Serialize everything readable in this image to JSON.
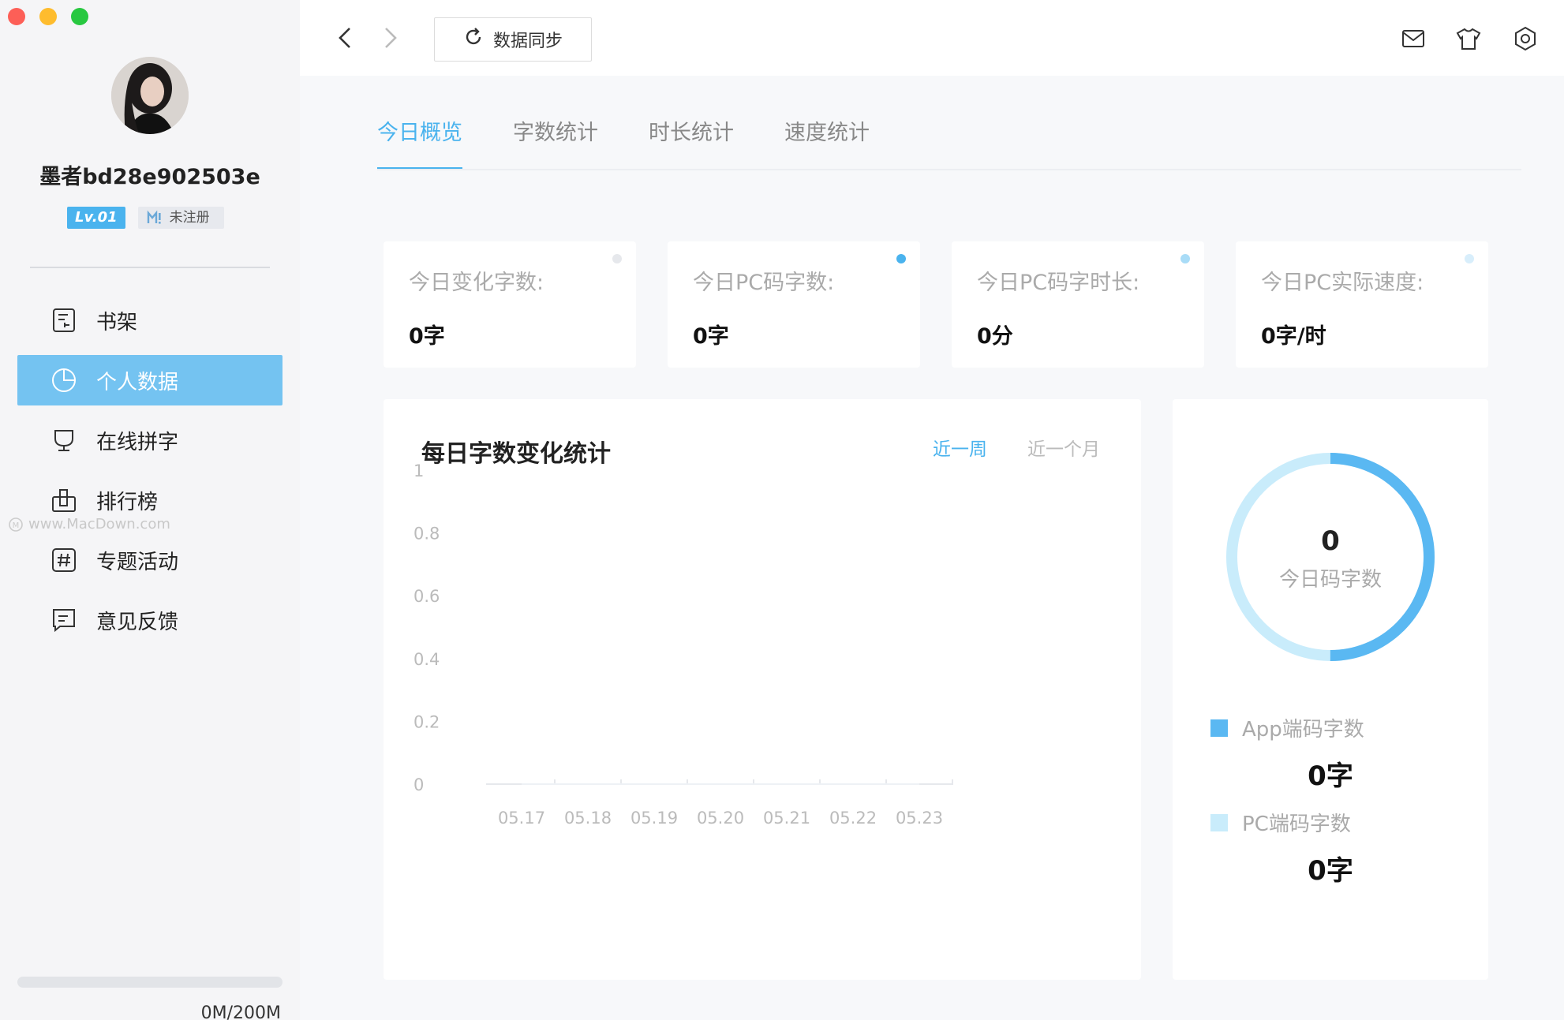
{
  "window": {
    "traffic_lights": [
      "close",
      "minimize",
      "zoom"
    ]
  },
  "sidebar": {
    "username": "墨者bd28e902503e",
    "level_badge": "Lv.01",
    "register_badge": "未注册",
    "items": [
      {
        "label": "书架",
        "icon": "bookshelf-icon"
      },
      {
        "label": "个人数据",
        "icon": "pie-chart-icon",
        "active": true
      },
      {
        "label": "在线拼字",
        "icon": "trophy-icon"
      },
      {
        "label": "排行榜",
        "icon": "ranking-icon"
      },
      {
        "label": "专题活动",
        "icon": "hashtag-icon"
      },
      {
        "label": "意见反馈",
        "icon": "feedback-icon"
      }
    ],
    "watermark": "www.MacDown.com",
    "storage": {
      "text": "0M/200M",
      "used_fraction": 0
    }
  },
  "topbar": {
    "sync_label": "数据同步",
    "icons": [
      "mail-icon",
      "tshirt-icon",
      "settings-icon"
    ]
  },
  "tabs": [
    {
      "label": "今日概览",
      "active": true
    },
    {
      "label": "字数统计"
    },
    {
      "label": "时长统计"
    },
    {
      "label": "速度统计"
    }
  ],
  "stats": [
    {
      "label": "今日变化字数:",
      "value": "0字",
      "dot_color": "#e6e8ec"
    },
    {
      "label": "今日PC码字数:",
      "value": "0字",
      "dot_color": "#4ab3ee"
    },
    {
      "label": "今日PC码字时长:",
      "value": "0分",
      "dot_color": "#a9dcf7"
    },
    {
      "label": "今日PC实际速度:",
      "value": "0字/时",
      "dot_color": "#d8eefb"
    }
  ],
  "daily_chart": {
    "title": "每日字数变化统计",
    "range_week": "近一周",
    "range_month": "近一个月"
  },
  "chart_data": {
    "type": "line",
    "title": "每日字数变化统计",
    "categories": [
      "05.17",
      "05.18",
      "05.19",
      "05.20",
      "05.21",
      "05.22",
      "05.23"
    ],
    "values": [
      0,
      0,
      0,
      0,
      0,
      0,
      0
    ],
    "y_ticks": [
      "1",
      "0.8",
      "0.6",
      "0.4",
      "0.2",
      "0"
    ],
    "ylim": [
      0,
      1
    ],
    "grid": false
  },
  "donut": {
    "value": "0",
    "label": "今日码字数",
    "colors": {
      "app": "#5ab8f2",
      "pc": "#c9ecfb"
    },
    "app_fraction": 0.5,
    "legend": [
      {
        "label": "App端码字数",
        "value": "0字",
        "color": "#5ab8f2"
      },
      {
        "label": "PC端码字数",
        "value": "0字",
        "color": "#c9ecfb"
      }
    ]
  }
}
